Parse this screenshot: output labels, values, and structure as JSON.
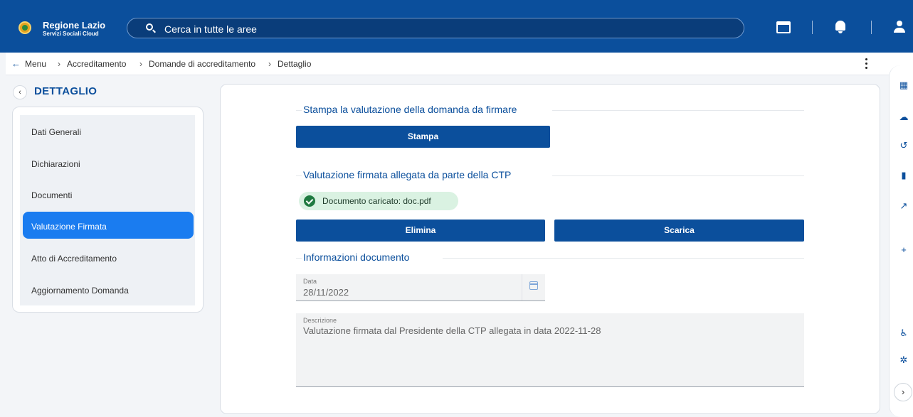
{
  "header": {
    "brand_title": "Regione Lazio",
    "brand_subtitle": "Servizi Sociali Cloud",
    "search_placeholder": "Cerca in tutte le aree"
  },
  "breadcrumb": {
    "back": "←",
    "items": [
      "Menu",
      "Accreditamento",
      "Domande di accreditamento",
      "Dettaglio"
    ],
    "separator": "›"
  },
  "sidebar": {
    "title": "DETTAGLIO",
    "back": "‹",
    "items": [
      {
        "label": "Dati Generali",
        "active": false
      },
      {
        "label": "Dichiarazioni",
        "active": false
      },
      {
        "label": "Documenti",
        "active": false
      },
      {
        "label": "Valutazione Firmata",
        "active": true
      },
      {
        "label": "Atto di Accreditamento",
        "active": false
      },
      {
        "label": "Aggiornamento Domanda",
        "active": false
      }
    ]
  },
  "main": {
    "section_print": "Stampa la valutazione della domanda da firmare",
    "print_button": "Stampa",
    "section_signed": "Valutazione firmata allegata da parte della CTP",
    "uploaded_chip": "Documento caricato: doc.pdf",
    "delete_button": "Elimina",
    "download_button": "Scarica",
    "section_info": "Informazioni documento",
    "date_label": "Data",
    "date_value": "28/11/2022",
    "description_label": "Descrizione",
    "description_value": "Valutazione firmata dal Presidente della CTP allegata in data 2022-11-28"
  },
  "right_bar": {
    "icons": [
      "calculator-icon",
      "weather-icon",
      "history-icon",
      "bookmark-icon",
      "trend-icon",
      "plus-icon",
      "accessibility-icon",
      "settings-icon"
    ],
    "collapse": "›"
  },
  "colors": {
    "primary": "#0b4f9c",
    "active": "#1a7cf0",
    "success_bg": "#daf2e2",
    "success": "#1f7a40"
  }
}
